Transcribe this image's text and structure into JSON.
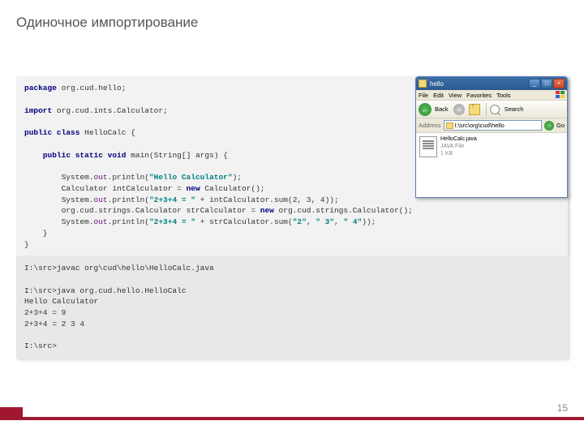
{
  "title": "Одиночное импортирование",
  "page_number": "15",
  "code": {
    "package_kw": "package",
    "package_name": " org.cud.hello;",
    "import_kw": "import",
    "import_name": " org.cud.ints.Calculator;",
    "public_kw": "public",
    "class_kw": "class",
    "class_name": " HelloCalc {",
    "main_public": "public",
    "main_static": "static",
    "main_void": "void",
    "main_sig": " main(String[] args) {",
    "sys": "System.",
    "out": "out",
    "println": ".println(",
    "str_hello": "\"Hello Calculator\"",
    "close_paren": ");",
    "calc_decl": "        Calculator intCalculator = ",
    "new_kw": "new",
    "calc_ctor": " Calculator();",
    "str_expr": "\"2+3+4 = \"",
    "plus_int": " + intCalculator.sum(2, 3, 4));",
    "str_decl": "        org.cud.strings.Calculator strCalculator = ",
    "str_ctor": " org.cud.strings.Calculator();",
    "plus_str_call": " + strCalculator.sum(",
    "arg2": "\"2\"",
    "comma": ", ",
    "arg3": "\" 3\"",
    "arg4": "\" 4\"",
    "close2": "));",
    "brace_in": "    }",
    "brace_out": "}"
  },
  "terminal": {
    "l1": "I:\\src>javac org\\cud\\hello\\HelloCalc.java",
    "l2": "",
    "l3": "I:\\src>java org.cud.hello.HelloCalc",
    "l4": "Hello Calculator",
    "l5": "2+3+4 = 9",
    "l6": "2+3+4 = 2 3 4",
    "l7": "",
    "l8": "I:\\src>"
  },
  "explorer": {
    "title": "hello",
    "menu": {
      "file": "File",
      "edit": "Edit",
      "view": "View",
      "fav": "Favorites",
      "tools": "Tools"
    },
    "toolbar": {
      "back": "Back",
      "search": "Search"
    },
    "address_label": "Address",
    "address_path": "I:\\src\\org\\cud\\hello",
    "go": "Go",
    "file": {
      "name": "HelloCalc.java",
      "type": "JAVA File",
      "size": "1 KB"
    }
  }
}
